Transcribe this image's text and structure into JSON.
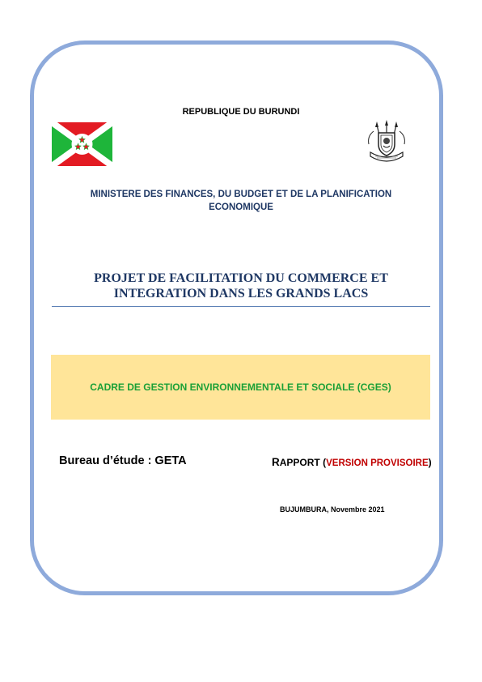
{
  "header": {
    "republic": "REPUBLIQUE DU BURUNDI",
    "ministry_line1": "MINISTERE DES FINANCES, DU BUDGET ET DE LA PLANIFICATION",
    "ministry_line2": "ECONOMIQUE"
  },
  "project": {
    "title_line1": "PROJET DE FACILITATION DU COMMERCE ET",
    "title_line2": "INTEGRATION DANS LES GRANDS LACS"
  },
  "banner": {
    "text": "CADRE DE GESTION ENVIRONNEMENTALE ET SOCIALE (CGES)"
  },
  "footer": {
    "bureau": "Bureau d’étude : GETA",
    "rapport_cap": "R",
    "rapport_rest": "APPORT",
    "rapport_open": " (",
    "rapport_version": "VERSION PROVISOIRE",
    "rapport_close": ")",
    "date": "BUJUMBURA, Novembre 2021"
  },
  "colors": {
    "frame": "#8eaadb",
    "navy_text": "#1f3864",
    "banner_bg": "#ffe599",
    "banner_text": "#1aa037",
    "red_text": "#c00000",
    "flag_red": "#e31b23",
    "flag_green": "#1eb53a"
  },
  "icons": {
    "flag": "burundi-flag-icon",
    "coat": "burundi-coat-of-arms-icon"
  }
}
